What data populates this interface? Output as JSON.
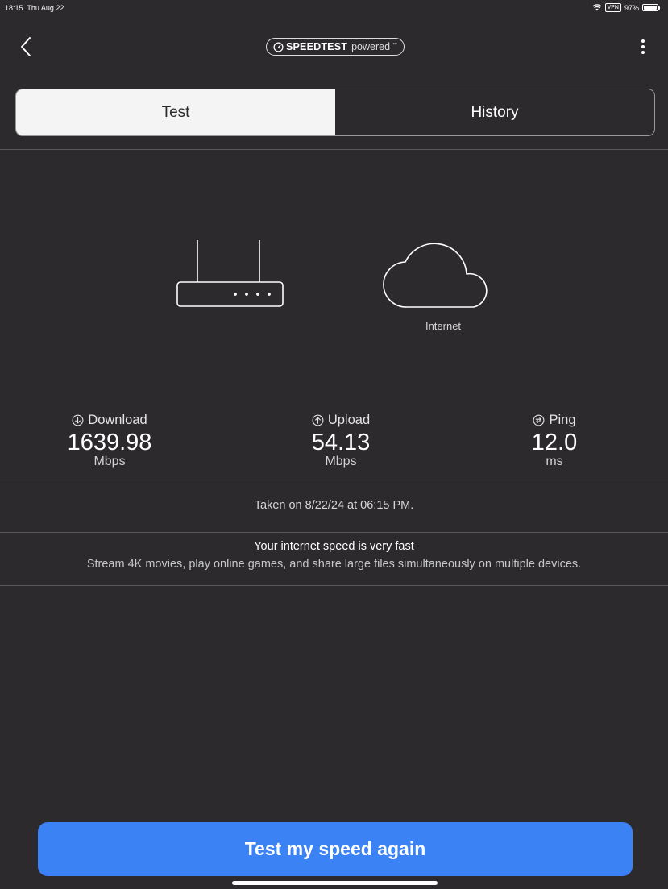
{
  "status_bar": {
    "time": "18:15",
    "date": "Thu Aug 22",
    "vpn": "VPN",
    "battery": "97%",
    "battery_level": 0.97,
    "icons": [
      "wifi-icon",
      "battery-icon"
    ]
  },
  "nav": {
    "back_icon": "chevron-left-icon",
    "brand_bold": "SPEEDTEST",
    "brand_light": "powered",
    "brand_mark": "™",
    "more_icon": "vertical-ellipsis-icon"
  },
  "tabs": [
    {
      "label": "Test",
      "active": true
    },
    {
      "label": "History",
      "active": false
    }
  ],
  "diagram": {
    "router_icon": "router-icon",
    "cloud_icon": "cloud-icon",
    "internet_label": "Internet"
  },
  "metrics": {
    "download": {
      "label": "Download",
      "value": "1639.98",
      "unit": "Mbps",
      "icon": "arrow-down-circle-icon"
    },
    "upload": {
      "label": "Upload",
      "value": "54.13",
      "unit": "Mbps",
      "icon": "arrow-up-circle-icon"
    },
    "ping": {
      "label": "Ping",
      "value": "12.0",
      "unit": "ms",
      "icon": "ping-circle-icon"
    }
  },
  "taken_text": "Taken on 8/22/24 at 06:15 PM.",
  "verdict": {
    "title": "Your internet speed is very fast",
    "description": "Stream 4K movies, play online games, and share large files simultaneously on multiple devices."
  },
  "cta": {
    "label": "Test my speed again"
  },
  "colors": {
    "background": "#2c2a2d",
    "accent": "#3b82f4",
    "active_tab_bg": "#f4f4f4"
  }
}
